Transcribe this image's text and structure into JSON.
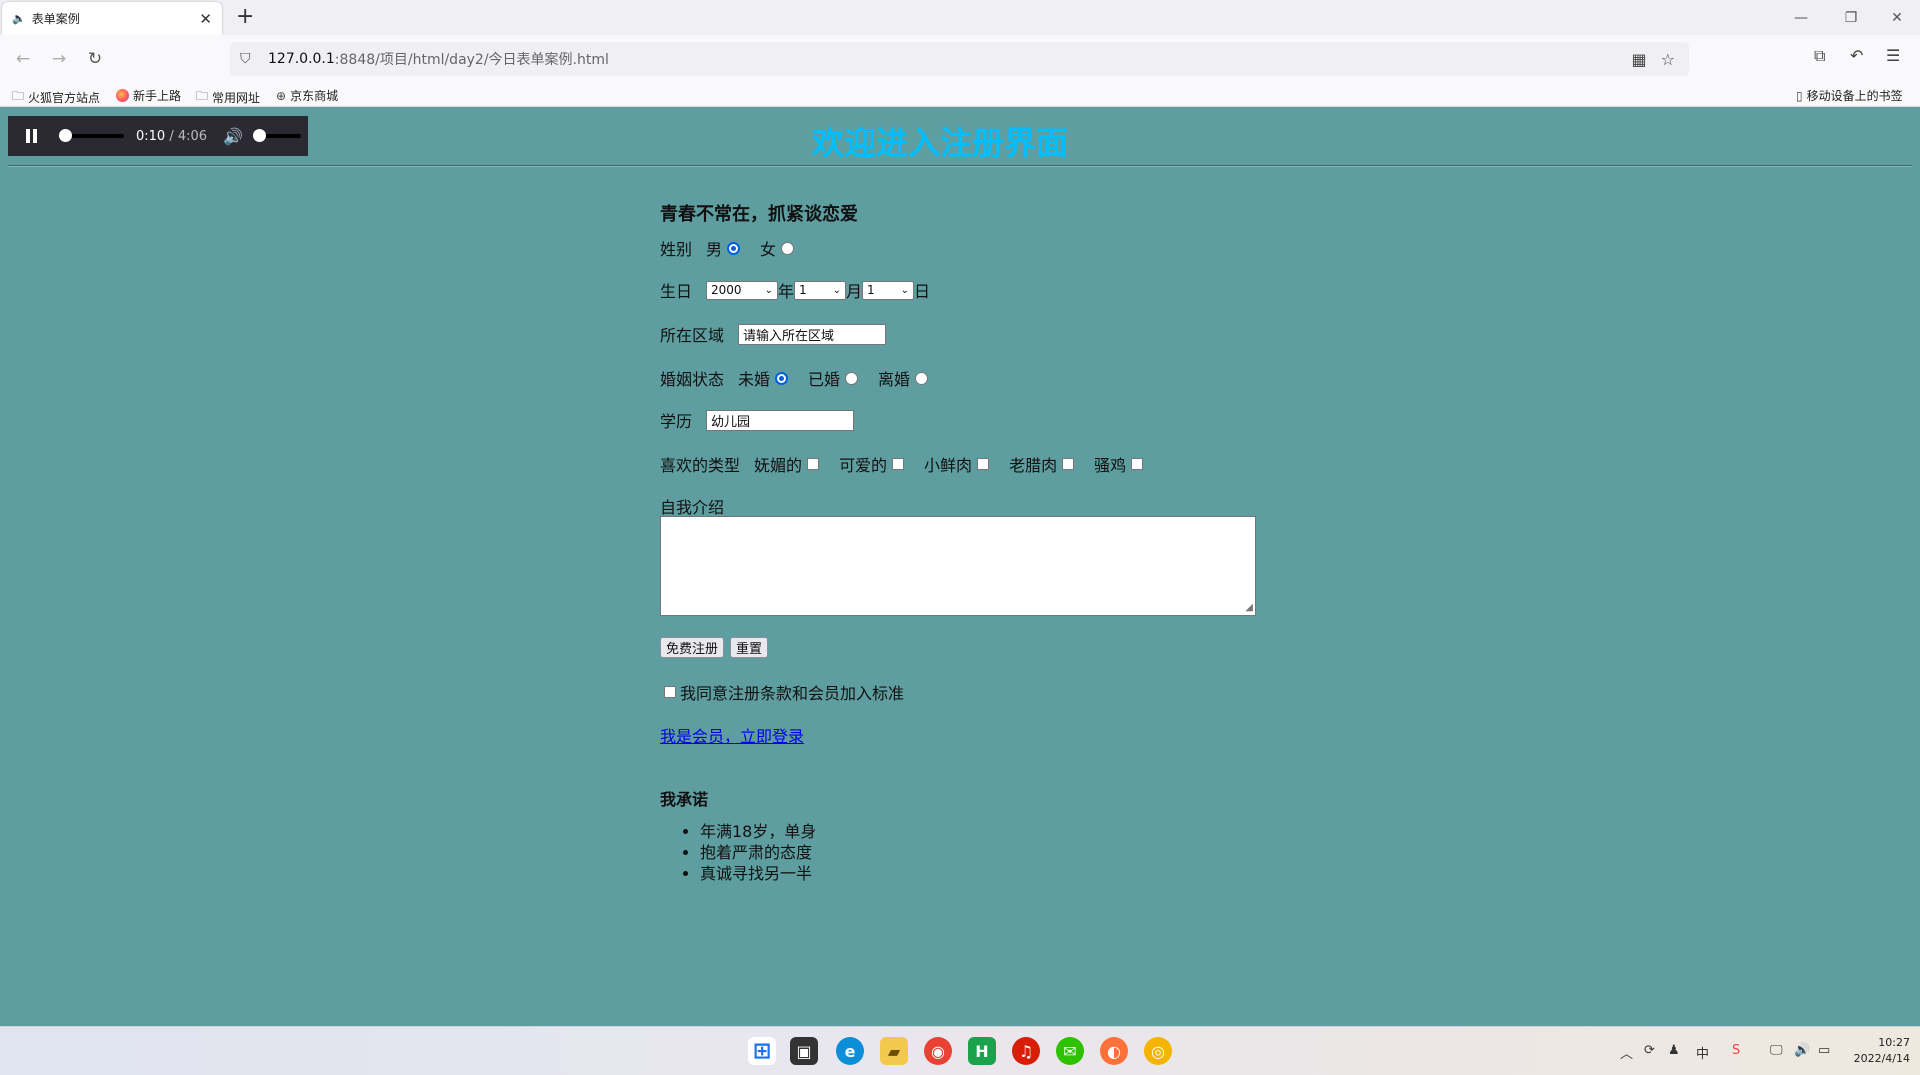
{
  "browser": {
    "tab_title": "表单案例",
    "url_host": "127.0.0.1",
    "url_path": ":8848/项目/html/day2/今日表单案例.html",
    "bookmarks": [
      "火狐官方站点",
      "新手上路",
      "常用网址",
      "京东商城"
    ],
    "mobile_bookmarks": "移动设备上的书签"
  },
  "audio": {
    "current": "0:10",
    "separator": " / ",
    "duration": "4:06",
    "progress": 0.04,
    "volume": 0.0
  },
  "page": {
    "headline": "欢迎进入注册界面",
    "form_title": "青春不常在，抓紧谈恋爱",
    "gender": {
      "label": "姓别",
      "options": [
        "男",
        "女"
      ],
      "selected": "男"
    },
    "birthday": {
      "label": "生日",
      "year": "2000",
      "year_unit": "年",
      "month": "1",
      "month_unit": "月",
      "day": "1",
      "day_unit": "日"
    },
    "region": {
      "label": "所在区域",
      "value": "请输入所在区域"
    },
    "marriage": {
      "label": "婚姻状态",
      "options": [
        "未婚",
        "已婚",
        "离婚"
      ],
      "selected": "未婚"
    },
    "education": {
      "label": "学历",
      "value": "幼儿园"
    },
    "likes": {
      "label": "喜欢的类型",
      "options": [
        "妩媚的",
        "可爱的",
        "小鲜肉",
        "老腊肉",
        "骚鸡"
      ]
    },
    "intro": {
      "label": "自我介绍",
      "value": ""
    },
    "buttons": {
      "register": "免费注册",
      "reset": "重置"
    },
    "agree": "我同意注册条款和会员加入标准",
    "login_link": "我是会员，立即登录",
    "promise": {
      "title": "我承诺",
      "items": [
        "年满18岁，单身",
        "抱着严肃的态度",
        "真诚寻找另一半"
      ]
    }
  },
  "taskbar": {
    "time": "10:27",
    "date": "2022/4/14",
    "icons": [
      "windows-start",
      "task-view",
      "edge",
      "file-explorer",
      "chrome",
      "hbuilder",
      "netease-music",
      "wechat",
      "firefox",
      "chrome-canary"
    ]
  },
  "colors": {
    "page_bg": "#5f9ea0",
    "headline": "#00bfff",
    "link": "#0000ee"
  }
}
